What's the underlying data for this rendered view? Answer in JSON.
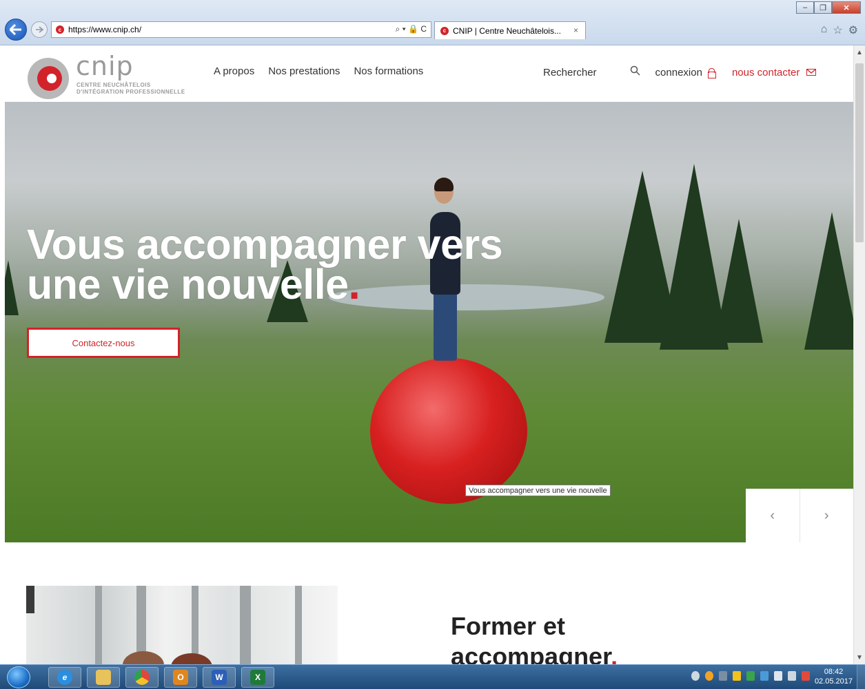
{
  "browser": {
    "url": "https://www.cnip.ch/",
    "tab_title": "CNIP | Centre Neuchâtelois...",
    "tab_close": "×",
    "address_tools": "⌕ ▾ 🔒 C",
    "window_minimize": "–",
    "window_maximize": "❐",
    "window_close": "✕"
  },
  "site": {
    "logo": {
      "word": "cnip",
      "sub_line1": "CENTRE NEUCHÂTELOIS",
      "sub_line2": "D'INTÉGRATION PROFESSIONNELLE"
    },
    "nav": {
      "items": [
        "A propos",
        "Nos prestations",
        "Nos formations"
      ],
      "search_label": "Rechercher",
      "login_label": "connexion",
      "contact_label": "nous contacter"
    },
    "hero": {
      "title_line1": "Vous accompagner vers",
      "title_line2": "une vie nouvelle",
      "title_dot": ".",
      "cta_label": "Contactez-nous",
      "tooltip": "Vous accompagner vers une vie nouvelle",
      "prev_arrow": "‹",
      "next_arrow": "›"
    },
    "section": {
      "title_line1": "Former et",
      "title_line2": "accompagner",
      "title_dot": "."
    }
  },
  "taskbar": {
    "apps": [
      {
        "name": "internet-explorer",
        "glyph": "e",
        "color": "#2a8fe0"
      },
      {
        "name": "file-explorer",
        "glyph": "",
        "color": "#e8c25a"
      },
      {
        "name": "chrome",
        "glyph": "",
        "color": "#e2463a"
      },
      {
        "name": "outlook",
        "glyph": "O",
        "color": "#e0861e"
      },
      {
        "name": "word",
        "glyph": "W",
        "color": "#2b5fb8"
      },
      {
        "name": "excel",
        "glyph": "X",
        "color": "#1f7a3a"
      }
    ],
    "time": "08:42",
    "date": "02.05.2017"
  },
  "colors": {
    "brand_red": "#d2232a",
    "logo_grey": "#9a9a9a"
  }
}
